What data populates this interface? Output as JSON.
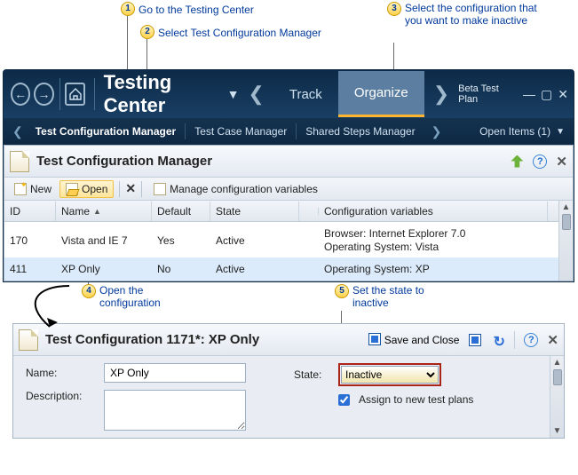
{
  "callouts": {
    "c1": "Go to the Testing Center",
    "c2": "Select Test Configuration Manager",
    "c3": "Select the configuration that you want to make inactive",
    "c4": "Open the configuration",
    "c5": "Set the state to inactive"
  },
  "header": {
    "title": "Testing Center",
    "tabs": {
      "track": "Track",
      "organize": "Organize"
    },
    "plan": "Beta Test Plan",
    "win": {
      "min": "—",
      "max": "▢",
      "close": "✕"
    }
  },
  "subnav": {
    "items": [
      "Test Configuration Manager",
      "Test Case Manager",
      "Shared Steps Manager"
    ],
    "open_items": "Open Items (1)"
  },
  "manager_panel": {
    "title": "Test Configuration Manager",
    "toolbar": {
      "new": "New",
      "open": "Open",
      "manage_vars": "Manage configuration variables"
    },
    "columns": {
      "id": "ID",
      "name": "Name",
      "default": "Default",
      "state": "State",
      "config_vars": "Configuration variables"
    },
    "rows": [
      {
        "id": "170",
        "name": "Vista and IE 7",
        "default": "Yes",
        "state": "Active",
        "config_vars": "Browser: Internet Explorer 7.0\nOperating System: Vista"
      },
      {
        "id": "411",
        "name": "XP Only",
        "default": "No",
        "state": "Active",
        "config_vars": "Operating System: XP"
      }
    ]
  },
  "config_panel": {
    "title": "Test Configuration 1171*: XP Only",
    "save_close": "Save and Close",
    "labels": {
      "name": "Name:",
      "description": "Description:",
      "state": "State:",
      "assign": "Assign to new test plans"
    },
    "values": {
      "name": "XP Only",
      "description": "",
      "state": "Inactive",
      "assign_checked": true
    }
  }
}
